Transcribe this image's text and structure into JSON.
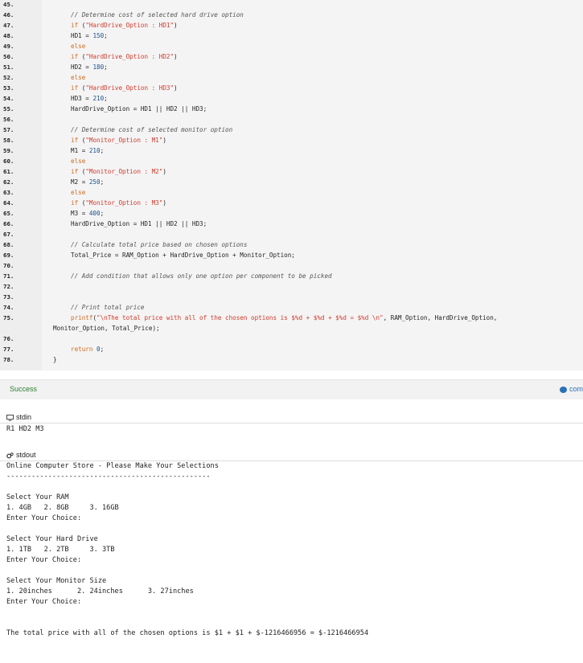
{
  "editor": {
    "lines": [
      {
        "num": "45.",
        "parts": []
      },
      {
        "num": "46.",
        "parts": [
          {
            "t": "cm",
            "v": "// Determine cost of selected hard drive option"
          }
        ]
      },
      {
        "num": "47.",
        "parts": [
          {
            "t": "kw",
            "v": "if"
          },
          {
            "t": "",
            "v": " ("
          },
          {
            "t": "str",
            "v": "\"HardDrive_Option : HD1\""
          },
          {
            "t": "",
            "v": ")"
          }
        ]
      },
      {
        "num": "48.",
        "parts": [
          {
            "t": "",
            "v": "HD1 = "
          },
          {
            "t": "nm",
            "v": "150"
          },
          {
            "t": "",
            "v": ";"
          }
        ]
      },
      {
        "num": "49.",
        "parts": [
          {
            "t": "kw",
            "v": "else"
          }
        ]
      },
      {
        "num": "50.",
        "parts": [
          {
            "t": "kw",
            "v": "if"
          },
          {
            "t": "",
            "v": " ("
          },
          {
            "t": "str",
            "v": "\"HardDrive_Option : HD2\""
          },
          {
            "t": "",
            "v": ")"
          }
        ]
      },
      {
        "num": "51.",
        "parts": [
          {
            "t": "",
            "v": "HD2 = "
          },
          {
            "t": "nm",
            "v": "180"
          },
          {
            "t": "",
            "v": ";"
          }
        ]
      },
      {
        "num": "52.",
        "parts": [
          {
            "t": "kw",
            "v": "else"
          }
        ]
      },
      {
        "num": "53.",
        "parts": [
          {
            "t": "kw",
            "v": "if"
          },
          {
            "t": "",
            "v": " ("
          },
          {
            "t": "str",
            "v": "\"HardDrive_Option : HD3\""
          },
          {
            "t": "",
            "v": ")"
          }
        ]
      },
      {
        "num": "54.",
        "parts": [
          {
            "t": "",
            "v": "HD3 = "
          },
          {
            "t": "nm",
            "v": "210"
          },
          {
            "t": "",
            "v": ";"
          }
        ]
      },
      {
        "num": "55.",
        "parts": [
          {
            "t": "",
            "v": "HardDrive_Option = HD1 || HD2 || HD3;"
          }
        ]
      },
      {
        "num": "56.",
        "parts": []
      },
      {
        "num": "57.",
        "parts": [
          {
            "t": "cm",
            "v": "// Determine cost of selected monitor option"
          }
        ]
      },
      {
        "num": "58.",
        "parts": [
          {
            "t": "kw",
            "v": "if"
          },
          {
            "t": "",
            "v": " ("
          },
          {
            "t": "str",
            "v": "\"Monitor_Option : M1\""
          },
          {
            "t": "",
            "v": ")"
          }
        ]
      },
      {
        "num": "59.",
        "parts": [
          {
            "t": "",
            "v": "M1 = "
          },
          {
            "t": "nm",
            "v": "210"
          },
          {
            "t": "",
            "v": ";"
          }
        ]
      },
      {
        "num": "60.",
        "parts": [
          {
            "t": "kw",
            "v": "else"
          }
        ]
      },
      {
        "num": "61.",
        "parts": [
          {
            "t": "kw",
            "v": "if"
          },
          {
            "t": "",
            "v": " ("
          },
          {
            "t": "str",
            "v": "\"Monitor_Option : M2\""
          },
          {
            "t": "",
            "v": ")"
          }
        ]
      },
      {
        "num": "62.",
        "parts": [
          {
            "t": "",
            "v": "M2 = "
          },
          {
            "t": "nm",
            "v": "250"
          },
          {
            "t": "",
            "v": ";"
          }
        ]
      },
      {
        "num": "63.",
        "parts": [
          {
            "t": "kw",
            "v": "else"
          }
        ]
      },
      {
        "num": "64.",
        "parts": [
          {
            "t": "kw",
            "v": "if"
          },
          {
            "t": "",
            "v": " ("
          },
          {
            "t": "str",
            "v": "\"Monitor_Option : M3\""
          },
          {
            "t": "",
            "v": ")"
          }
        ]
      },
      {
        "num": "65.",
        "parts": [
          {
            "t": "",
            "v": "M3 = "
          },
          {
            "t": "nm",
            "v": "400"
          },
          {
            "t": "",
            "v": ";"
          }
        ]
      },
      {
        "num": "66.",
        "parts": [
          {
            "t": "",
            "v": "HardDrive_Option = HD1 || HD2 || HD3;"
          }
        ]
      },
      {
        "num": "67.",
        "parts": []
      },
      {
        "num": "68.",
        "parts": [
          {
            "t": "cm",
            "v": "// Calculate total price based on chosen options"
          }
        ]
      },
      {
        "num": "69.",
        "parts": [
          {
            "t": "",
            "v": "Total_Price = RAM_Option + HardDrive_Option + Monitor_Option;"
          }
        ]
      },
      {
        "num": "70.",
        "parts": []
      },
      {
        "num": "71.",
        "parts": [
          {
            "t": "cm",
            "v": "// Add condition that allows only one option per component to be picked"
          }
        ]
      },
      {
        "num": "72.",
        "parts": []
      },
      {
        "num": "73.",
        "parts": []
      },
      {
        "num": "74.",
        "parts": [
          {
            "t": "cm",
            "v": "// Print total price"
          }
        ]
      },
      {
        "num": "75.",
        "parts": [
          {
            "t": "kw",
            "v": "printf"
          },
          {
            "t": "",
            "v": "("
          },
          {
            "t": "str",
            "v": "\"\\nThe total price with all of the chosen options is $%d + $%d + $%d = $%d \\n\""
          },
          {
            "t": "",
            "v": ", RAM_Option, HardDrive_Option,"
          }
        ]
      },
      {
        "num": "",
        "parts": [
          {
            "t": "",
            "v": "Monitor_Option, Total_Price);"
          }
        ],
        "wrap": true
      },
      {
        "num": "76.",
        "parts": []
      },
      {
        "num": "77.",
        "parts": [
          {
            "t": "kw",
            "v": "return"
          },
          {
            "t": "",
            "v": " "
          },
          {
            "t": "nm",
            "v": "0"
          },
          {
            "t": "",
            "v": ";"
          }
        ]
      },
      {
        "num": "78.",
        "parts": [
          {
            "t": "",
            "v": "}"
          }
        ],
        "outdent": true
      }
    ]
  },
  "status": {
    "label": "Success",
    "link": "com"
  },
  "stdin": {
    "title": "stdin",
    "value": "R1 HD2 M3"
  },
  "stdout": {
    "title": "stdout",
    "lines": [
      "Online Computer Store - Please Make Your Selections",
      "-------------------------------------------------",
      "",
      "Select Your RAM",
      "1. 4GB   2. 8GB     3. 16GB",
      "Enter Your Choice:",
      "",
      "Select Your Hard Drive",
      "1. 1TB   2. 2TB     3. 3TB",
      "Enter Your Choice:",
      "",
      "Select Your Monitor Size",
      "1. 20inches      2. 24inches      3. 27inches",
      "Enter Your Choice:",
      "",
      "",
      "The total price with all of the chosen options is $1 + $1 + $-1216466956 = $-1216466954"
    ]
  }
}
